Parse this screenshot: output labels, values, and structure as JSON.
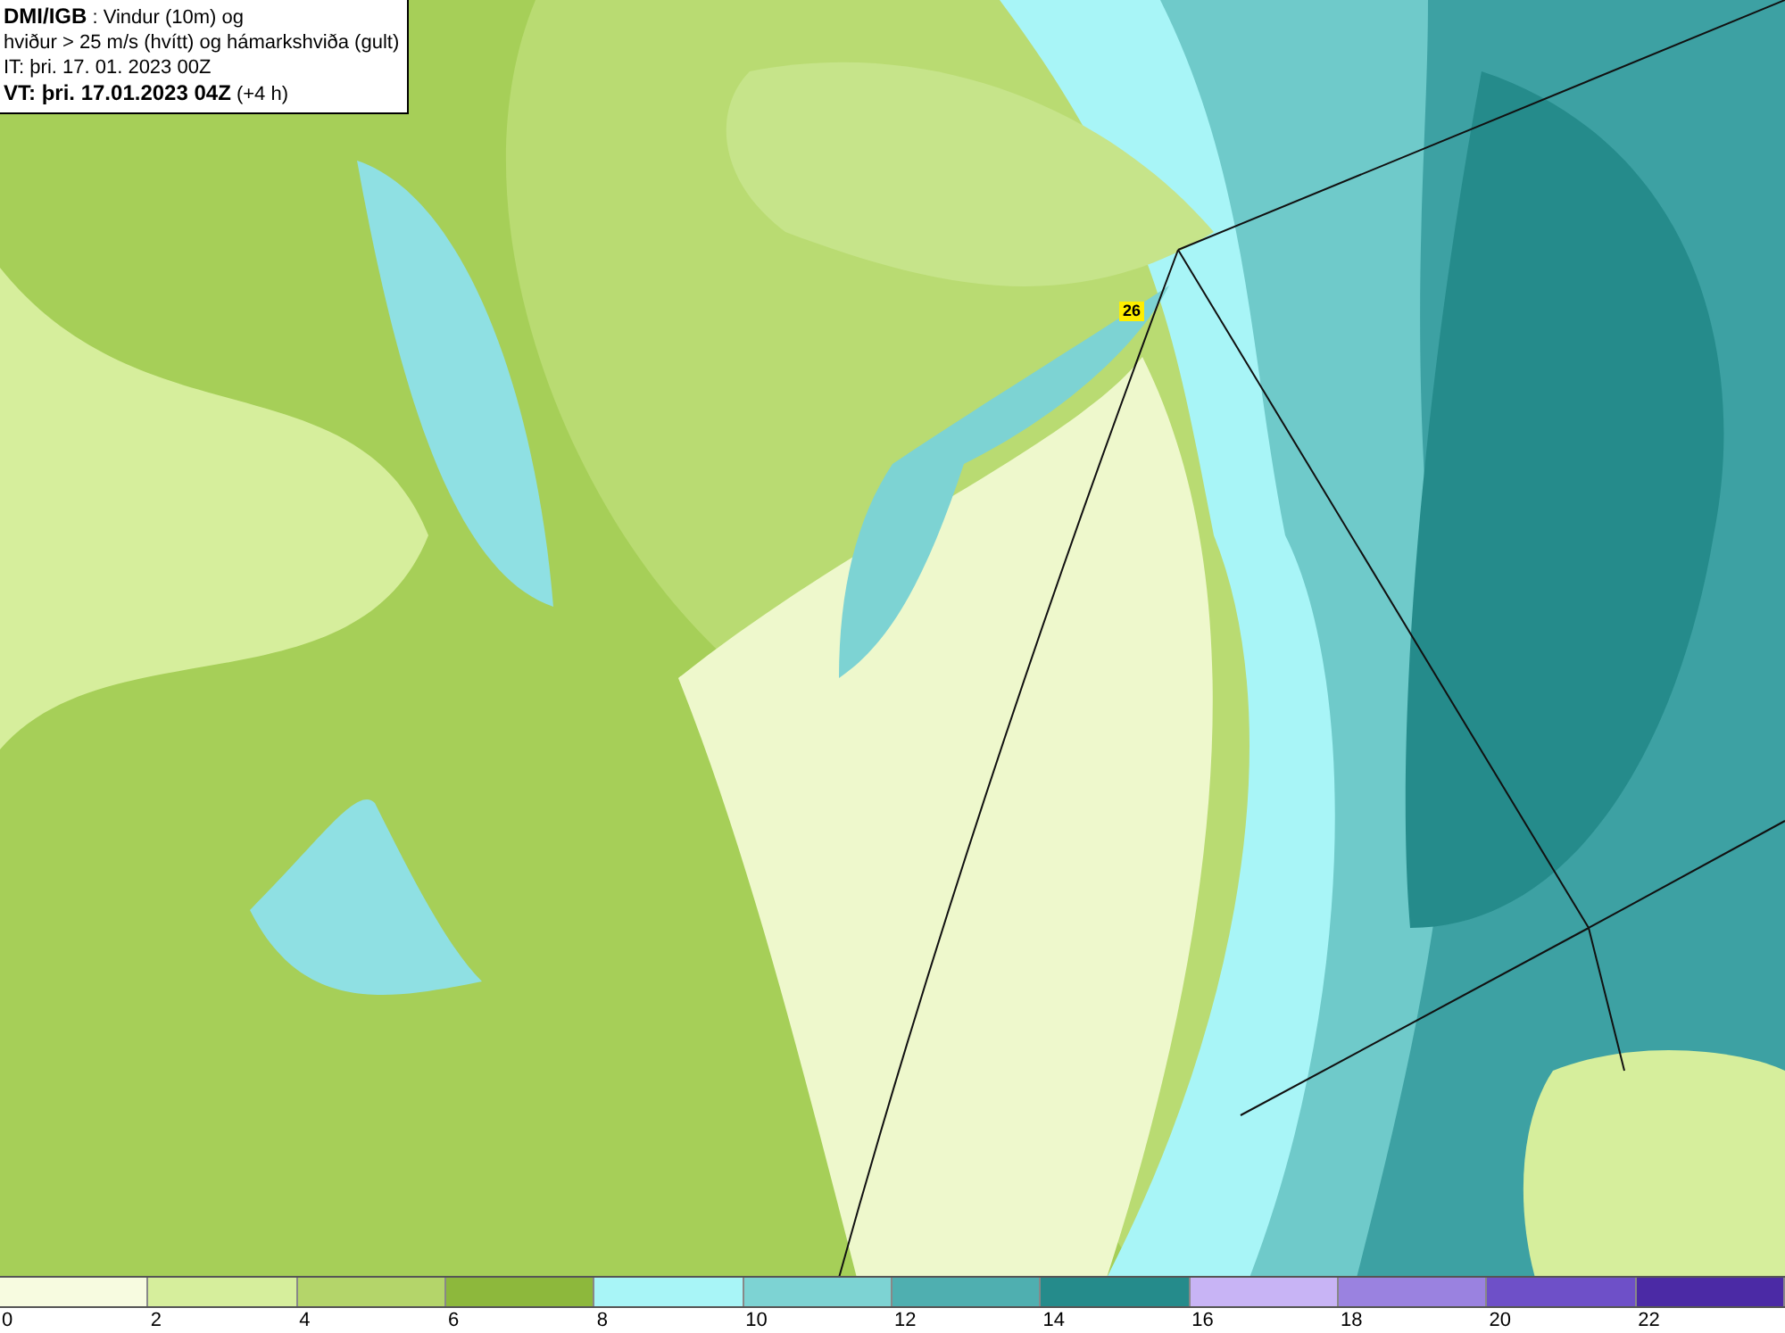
{
  "info_box": {
    "lines": [
      "**DMI/IGB** : Vindur (10m) og",
      "hviður > 25 m/s (hvítt) og hámarkshviða (gult)",
      "IT: þri. 17. 01. 2023 00Z",
      "**VT: þri. 17.01.2023 04Z** (+4 h)"
    ]
  },
  "map": {
    "max_gust_label": "26"
  },
  "legend": {
    "segments": [
      {
        "color": "#f7fbe0"
      },
      {
        "color": "#d6ee9c"
      },
      {
        "color": "#b4d56a"
      },
      {
        "color": "#8db83c"
      },
      {
        "color": "#a8f5f7"
      },
      {
        "color": "#7dd3d3"
      },
      {
        "color": "#4fafb0"
      },
      {
        "color": "#258b8b"
      },
      {
        "color": "#c8b4f5"
      },
      {
        "color": "#9a82e0"
      },
      {
        "color": "#6e50c8"
      },
      {
        "color": "#4b2aa5"
      }
    ],
    "ticks": [
      "0",
      "2",
      "4",
      "6",
      "8",
      "10",
      "12",
      "14",
      "16",
      "18",
      "20",
      "22"
    ]
  }
}
